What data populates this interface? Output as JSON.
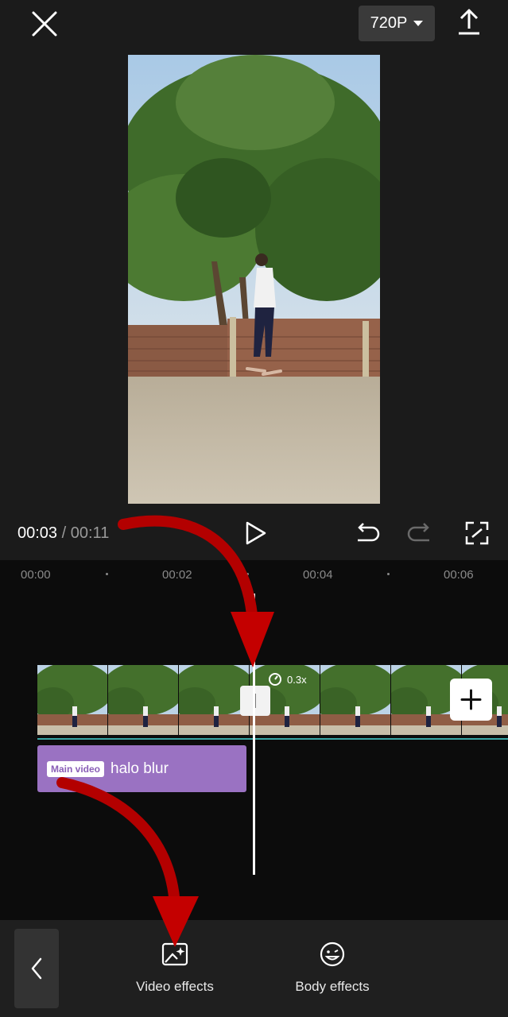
{
  "topbar": {
    "resolution": "720P"
  },
  "playback": {
    "current_time": "00:03",
    "separator": "/",
    "total_time": "00:11"
  },
  "timeline": {
    "ruler_labels": [
      "00:00",
      "00:02",
      "00:04",
      "00:06"
    ],
    "speed_label": "0.3x",
    "effect_clip": {
      "badge": "Main video",
      "name": "halo blur"
    }
  },
  "bottom_toolbar": {
    "tools": [
      {
        "label": "Video effects",
        "icon": "video-effects-icon"
      },
      {
        "label": "Body effects",
        "icon": "body-effects-icon"
      }
    ]
  },
  "colors": {
    "background": "#1b1b1b",
    "timeline_bg": "#0c0c0c",
    "effect_clip": "#9a72c2",
    "track_line": "#3ba7a6",
    "annotation_arrow": "#d00000"
  }
}
